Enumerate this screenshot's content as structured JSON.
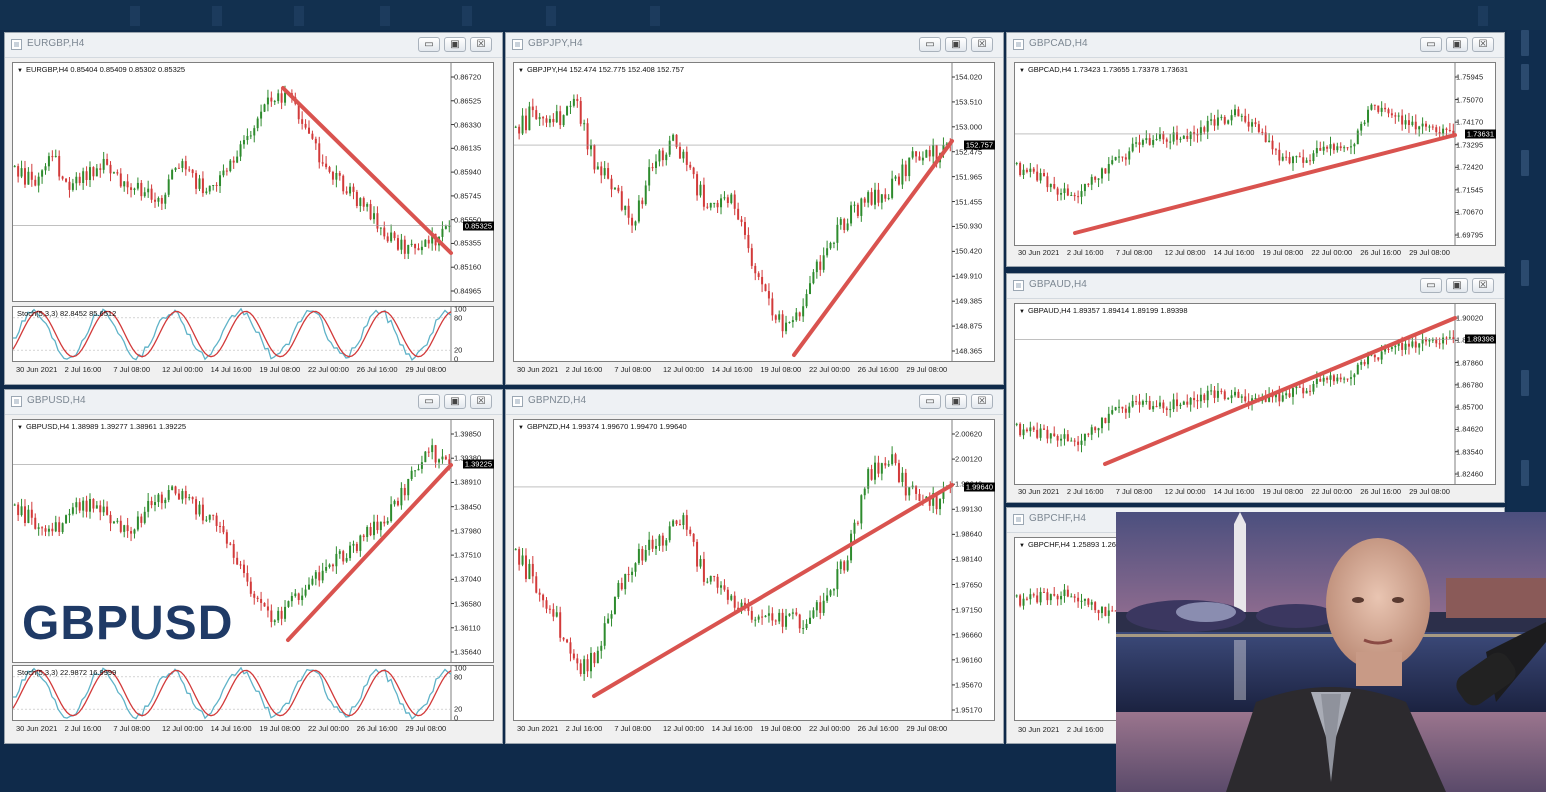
{
  "windows": [
    {
      "id": "eurgbp",
      "title": "EURGBP,H4",
      "info": "EURGBP,H4  0.85404 0.85409 0.85302 0.85325",
      "yticks": [
        "0.86720",
        "0.86525",
        "0.86330",
        "0.86135",
        "0.85940",
        "0.85745",
        "0.85550",
        "0.85355",
        "0.85160",
        "0.84965"
      ],
      "price": "0.85325",
      "stoch_label": "Stoch(5,3,3) 82.8452 85.6512",
      "stoch_ticks": [
        "100",
        "80",
        "20",
        "0"
      ],
      "xticks": [
        "30 Jun 2021",
        "2 Jul 16:00",
        "7 Jul 08:00",
        "12 Jul 00:00",
        "14 Jul 16:00",
        "19 Jul 08:00",
        "22 Jul 00:00",
        "26 Jul 16:00",
        "29 Jul 08:00"
      ]
    },
    {
      "id": "gbpjpy",
      "title": "GBPJPY,H4",
      "info": "GBPJPY,H4  152.474 152.775 152.408 152.757",
      "yticks": [
        "154.020",
        "153.510",
        "153.000",
        "152.475",
        "151.965",
        "151.455",
        "150.930",
        "150.420",
        "149.910",
        "149.385",
        "148.875",
        "148.365"
      ],
      "price": "152.757",
      "xticks": [
        "30 Jun 2021",
        "2 Jul 16:00",
        "7 Jul 08:00",
        "12 Jul 00:00",
        "14 Jul 16:00",
        "19 Jul 08:00",
        "22 Jul 00:00",
        "26 Jul 16:00",
        "29 Jul 08:00"
      ]
    },
    {
      "id": "gbpcad",
      "title": "GBPCAD,H4",
      "info": "GBPCAD,H4  1.73423 1.73655 1.73378 1.73631",
      "yticks": [
        "1.75945",
        "1.75070",
        "1.74170",
        "1.73295",
        "1.72420",
        "1.71545",
        "1.70670",
        "1.69795"
      ],
      "price": "1.73631",
      "xticks": [
        "30 Jun 2021",
        "2 Jul 16:00",
        "7 Jul 08:00",
        "12 Jul 08:00",
        "14 Jul 16:00",
        "19 Jul 08:00",
        "22 Jul 00:00",
        "26 Jul 16:00",
        "29 Jul 08:00"
      ]
    },
    {
      "id": "gbpaud",
      "title": "GBPAUD,H4",
      "info": "GBPAUD,H4  1.89357 1.89414 1.89199 1.89398",
      "yticks": [
        "1.90020",
        "1.88940",
        "1.87860",
        "1.86780",
        "1.85700",
        "1.84620",
        "1.83540",
        "1.82460"
      ],
      "price": "1.89398",
      "xticks": [
        "30 Jun 2021",
        "2 Jul 16:00",
        "7 Jul 08:00",
        "12 Jul 00:00",
        "14 Jul 16:00",
        "19 Jul 08:00",
        "22 Jul 00:00",
        "26 Jul 16:00",
        "29 Jul 08:00"
      ]
    },
    {
      "id": "gbpusd",
      "title": "GBPUSD,H4",
      "info": "GBPUSD,H4  1.38989 1.39277 1.38961 1.39225",
      "yticks": [
        "1.39850",
        "1.39380",
        "1.38910",
        "1.38450",
        "1.37980",
        "1.37510",
        "1.37040",
        "1.36580",
        "1.36110",
        "1.35640"
      ],
      "price": "1.39225",
      "stoch_label": "Stoch(5,3,3) 22.9872 16.9999",
      "stoch_ticks": [
        "100",
        "80",
        "20",
        "0"
      ],
      "xticks": [
        "30 Jun 2021",
        "2 Jul 16:00",
        "7 Jul 08:00",
        "12 Jul 00:00",
        "14 Jul 16:00",
        "19 Jul 08:00",
        "22 Jul 00:00",
        "26 Jul 16:00",
        "29 Jul 08:00"
      ]
    },
    {
      "id": "gbpnzd",
      "title": "GBPNZD,H4",
      "info": "GBPNZD,H4  1.99374 1.99670 1.99470 1.99640",
      "yticks": [
        "2.00620",
        "2.00120",
        "1.99640",
        "1.99130",
        "1.98640",
        "1.98140",
        "1.97650",
        "1.97150",
        "1.96660",
        "1.96160",
        "1.95670",
        "1.95170"
      ],
      "price": "1.99640",
      "xticks": [
        "30 Jun 2021",
        "2 Jul 16:00",
        "7 Jul 08:00",
        "12 Jul 00:00",
        "14 Jul 16:00",
        "19 Jul 08:00",
        "22 Jul 00:00",
        "26 Jul 16:00",
        "29 Jul 08:00"
      ]
    },
    {
      "id": "gbpchf",
      "title": "GBPCHF,H4",
      "info": "GBPCHF,H4  1.25893 1.26",
      "xticks": [
        "30 Jun 2021",
        "2 Jul 16:00"
      ]
    }
  ],
  "window_buttons": {
    "minimize": "▭",
    "restore": "▣",
    "close": "☒"
  },
  "overlay": {
    "symbol": "GBPUSD"
  },
  "colors": {
    "bull": "#2e8b2e",
    "bear": "#d23a3a",
    "trend": "#d9534f",
    "stoch_main": "#5fb3c8",
    "stoch_signal": "#d23a3a"
  }
}
